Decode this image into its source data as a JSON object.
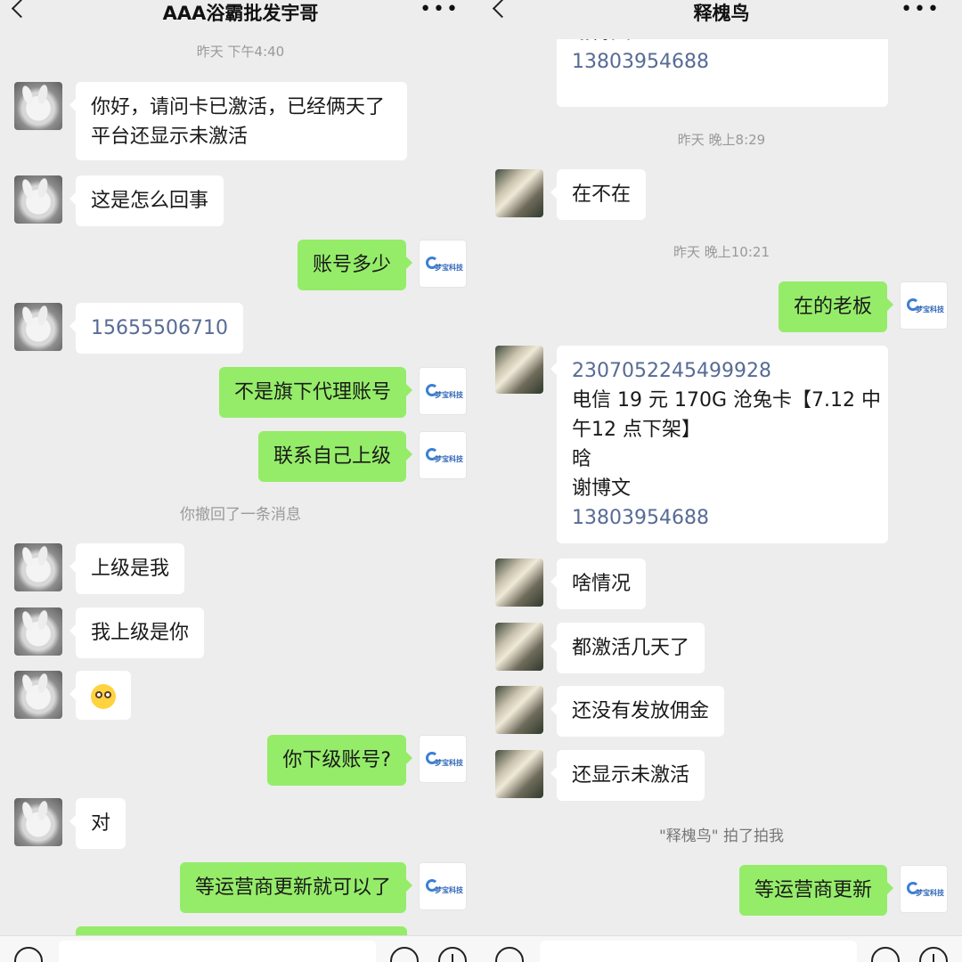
{
  "left": {
    "title": "AAA浴霸批发宇哥",
    "timestamp": "昨天 下午4:40",
    "recalled": "你撤回了一条消息",
    "messages": [
      {
        "lines": [
          "你好，请问卡已激活，已经俩天了",
          "平台还显示未激活"
        ]
      },
      {
        "text": "这是怎么回事"
      },
      {
        "text": "账号多少"
      },
      {
        "text": "15655506710"
      },
      {
        "text": "不是旗下代理账号"
      },
      {
        "text": "联系自己上级"
      },
      {
        "text": "上级是我"
      },
      {
        "text": "我上级是你"
      },
      {
        "emoji": "flushed-face"
      },
      {
        "text": "你下级账号?"
      },
      {
        "text": "对"
      },
      {
        "text": "等运营商更新就可以了"
      }
    ]
  },
  "right": {
    "title": "释槐鸟",
    "top_partial": [
      "谢博文",
      "13803954688"
    ],
    "timestamps": [
      "昨天 晚上8:29",
      "昨天 晚上10:21"
    ],
    "pat_notice": "\"释槐鸟\" 拍了拍我",
    "messages": [
      {
        "text": "在不在"
      },
      {
        "text": "在的老板"
      },
      {
        "lines": [
          "2307052245499928",
          "电信 19 元 170G 沧兔卡【7.12 中",
          "午12 点下架】",
          "晗",
          "谢博文",
          "13803954688"
        ]
      },
      {
        "text": "啥情况"
      },
      {
        "text": "都激活几天了"
      },
      {
        "text": "还没有发放佣金"
      },
      {
        "text": "还显示未激活"
      },
      {
        "text": "等运营商更新"
      }
    ]
  },
  "logo_text": "梦宝科技",
  "colors": {
    "outgoing_bubble": "#95ec69",
    "incoming_bubble": "#ffffff",
    "link": "#576b95",
    "background": "#ededed"
  }
}
